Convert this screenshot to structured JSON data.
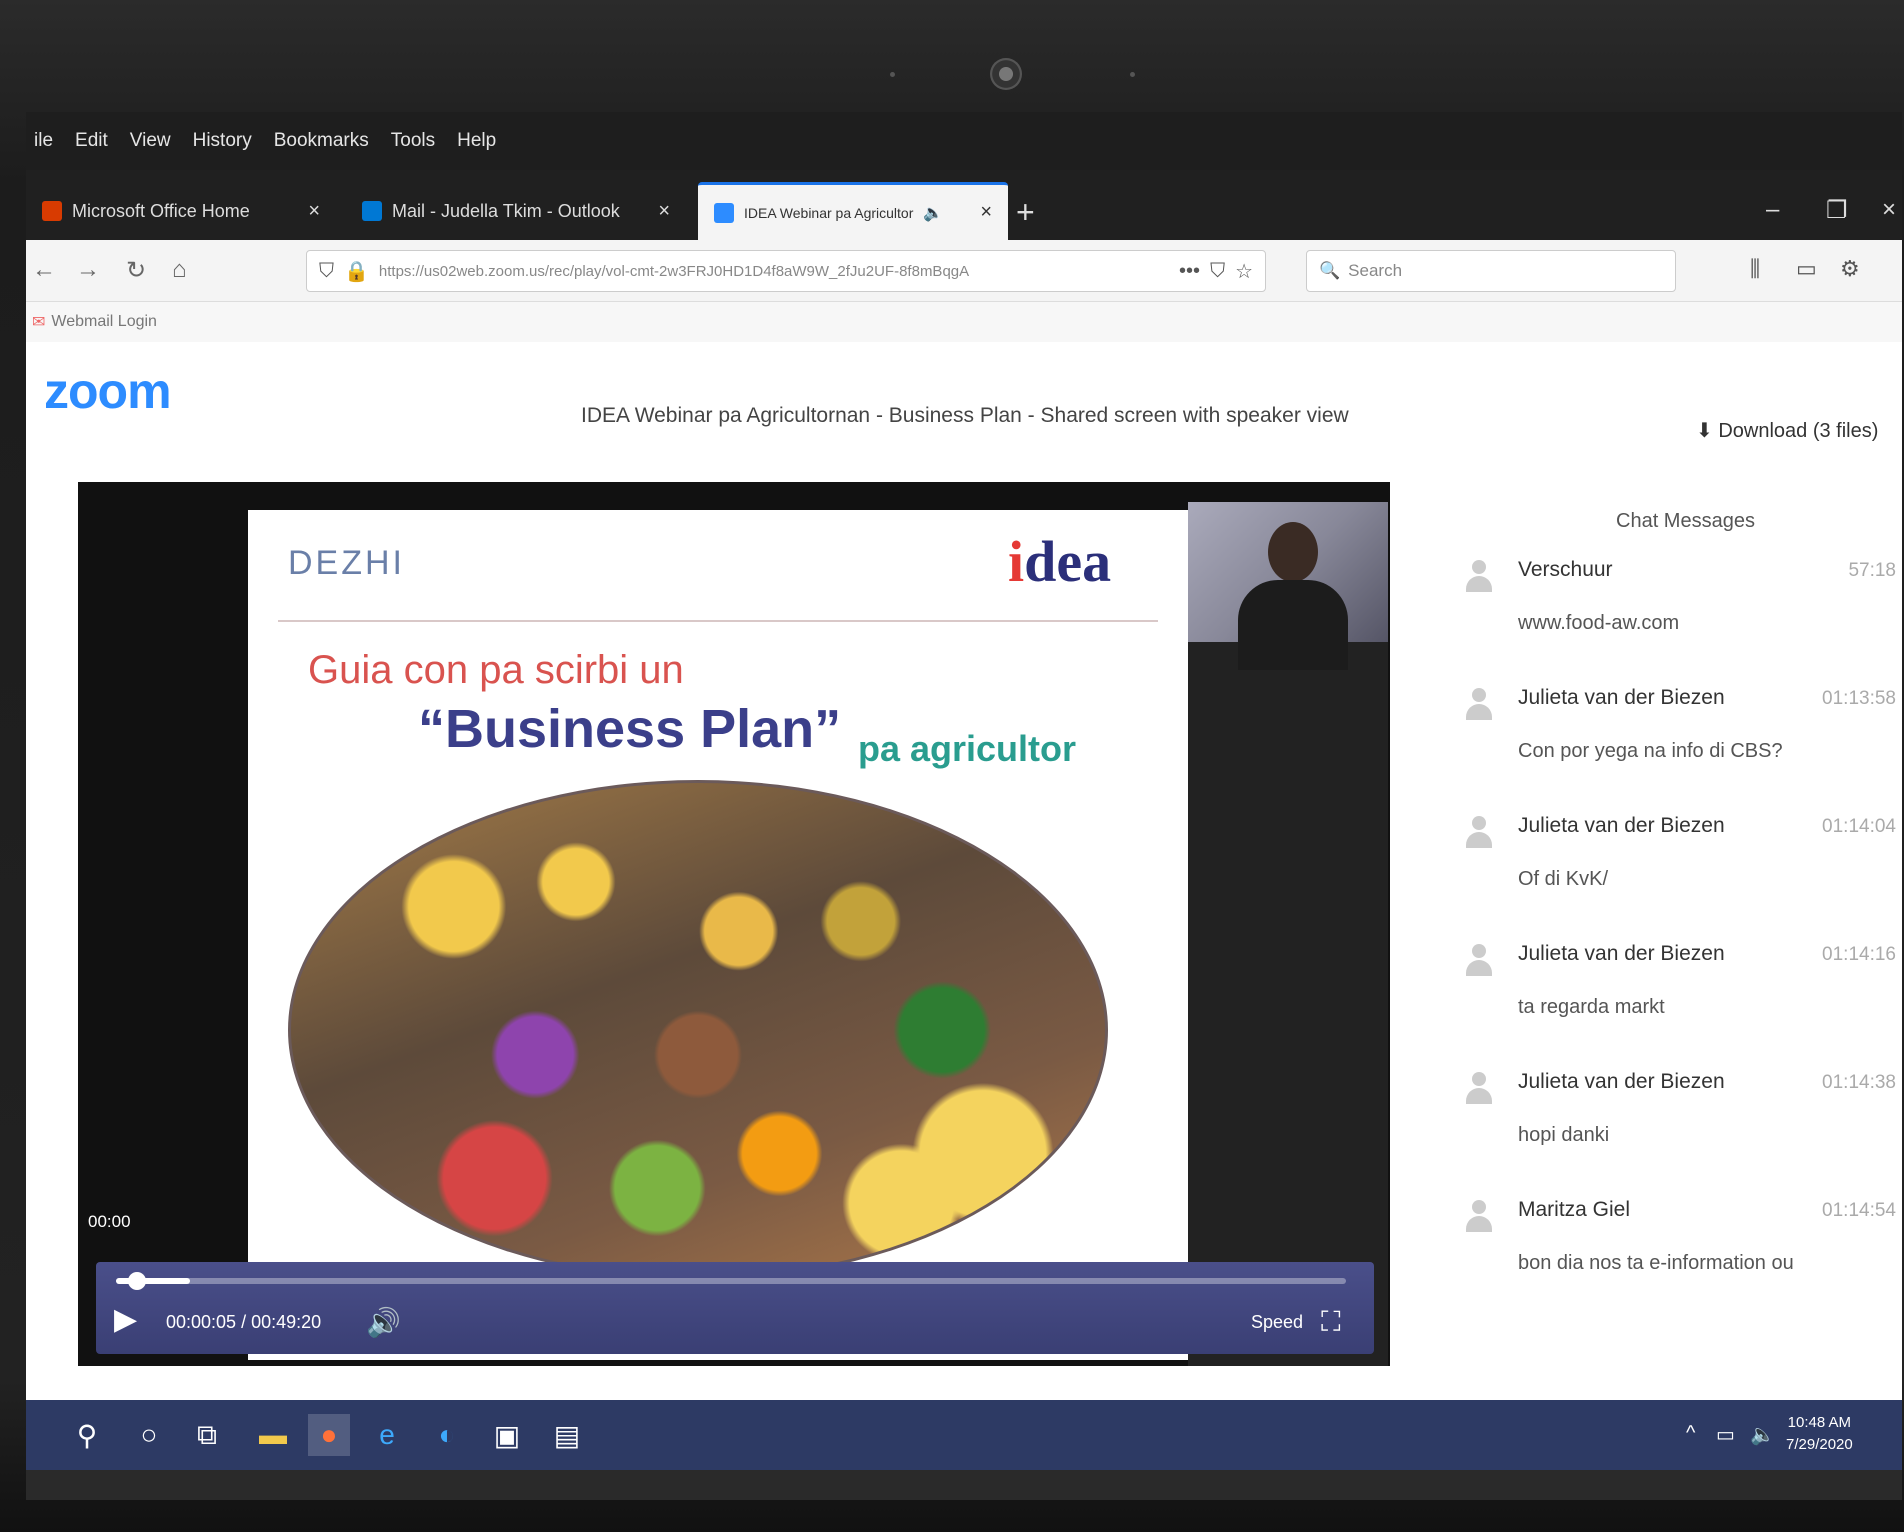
{
  "browser": {
    "menu": [
      "ile",
      "Edit",
      "View",
      "History",
      "Bookmarks",
      "Tools",
      "Help"
    ],
    "tabs": [
      {
        "label": "Microsoft Office Home",
        "favicon_color": "#d83b01"
      },
      {
        "label": "Mail - Judella Tkim - Outlook",
        "favicon_color": "#0078d4"
      },
      {
        "label": "IDEA Webinar pa Agricultor",
        "favicon_color": "#2D8CFF"
      }
    ],
    "url": "https://us02web.zoom.us/rec/play/vol-cmt-2w3FRJ0HD1D4f8aW9W_2fJu2UF-8f8mBqgA",
    "search_placeholder": "Search",
    "bookmark": "Webmail Login"
  },
  "zoom": {
    "logo": "zoom",
    "recording_title": "IDEA Webinar pa Agricultornan - Business Plan - Shared screen with speaker view",
    "download_label": "Download (3 files)"
  },
  "slide": {
    "logo_left": "DEZHI",
    "logo_right_dot": "i",
    "logo_right_rest": "dea",
    "line1": "Guia con pa scirbi un",
    "line2": "“Business Plan”",
    "line3": "pa agricultor"
  },
  "player": {
    "time_overlay": "00:00",
    "timecode": "00:00:05 / 00:49:20",
    "speed_label": "Speed",
    "progress": 0.06
  },
  "chat": {
    "title": "Chat Messages",
    "messages": [
      {
        "name": "Verschuur",
        "time": "57:18",
        "text": "www.food-aw.com"
      },
      {
        "name": "Julieta van der Biezen",
        "time": "01:13:58",
        "text": "Con por yega na info di CBS?"
      },
      {
        "name": "Julieta van der Biezen",
        "time": "01:14:04",
        "text": "Of di KvK/"
      },
      {
        "name": "Julieta van der Biezen",
        "time": "01:14:16",
        "text": "ta regarda markt"
      },
      {
        "name": "Julieta van der Biezen",
        "time": "01:14:38",
        "text": "hopi danki"
      },
      {
        "name": "Maritza Giel",
        "time": "01:14:54",
        "text": "bon dia nos ta e-information ou"
      }
    ]
  },
  "taskbar": {
    "time": "10:48 AM",
    "date": "7/29/2020"
  }
}
